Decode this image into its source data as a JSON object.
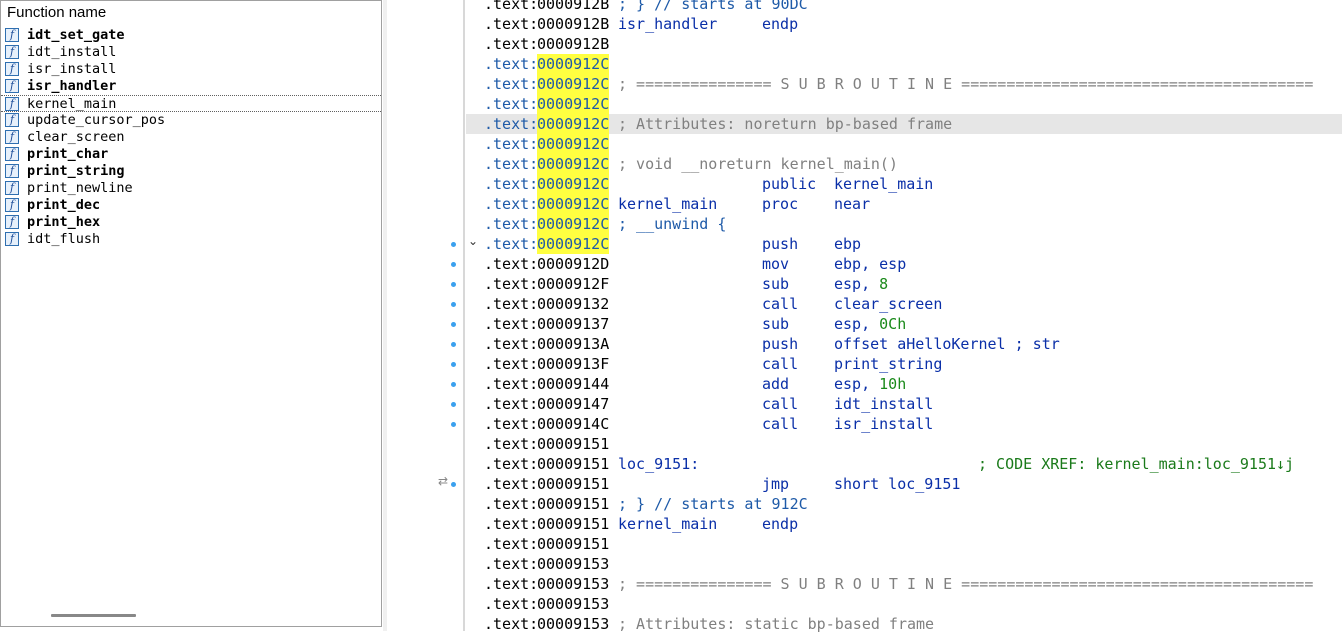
{
  "functions_panel": {
    "header": "Function name",
    "icon_glyph": "f",
    "items": [
      {
        "name": "idt_set_gate",
        "bold": true,
        "selected": false
      },
      {
        "name": "idt_install",
        "bold": false,
        "selected": false
      },
      {
        "name": "isr_install",
        "bold": false,
        "selected": false
      },
      {
        "name": "isr_handler",
        "bold": true,
        "selected": false
      },
      {
        "name": "kernel_main",
        "bold": false,
        "selected": true
      },
      {
        "name": "update_cursor_pos",
        "bold": false,
        "selected": false
      },
      {
        "name": "clear_screen",
        "bold": false,
        "selected": false
      },
      {
        "name": "print_char",
        "bold": true,
        "selected": false
      },
      {
        "name": "print_string",
        "bold": true,
        "selected": false
      },
      {
        "name": "print_newline",
        "bold": false,
        "selected": false
      },
      {
        "name": "print_dec",
        "bold": true,
        "selected": false
      },
      {
        "name": "print_hex",
        "bold": true,
        "selected": false
      },
      {
        "name": "idt_flush",
        "bold": false,
        "selected": false
      }
    ]
  },
  "disassembly": {
    "collapse_arrow": "⌄",
    "jump_arrow": "⇄",
    "lines": [
      {
        "seg": ".text:",
        "addr": "0000912B",
        "cmt_blue": "; } // starts at 90DC"
      },
      {
        "seg": ".text:",
        "addr": "0000912B",
        "label": "isr_handler",
        "mnem": "endp"
      },
      {
        "seg": ".text:",
        "addr": "0000912B"
      },
      {
        "seg": ".text:",
        "addr": "0000912C",
        "yellow": true
      },
      {
        "seg": ".text:",
        "addr": "0000912C",
        "yellow": true,
        "cmt_gray": "; =============== S U B R O U T I N E ======================================="
      },
      {
        "seg": ".text:",
        "addr": "0000912C",
        "yellow": true
      },
      {
        "seg": ".text:",
        "addr": "0000912C",
        "yellow": true,
        "highlight": true,
        "cmt_gray": "; Attributes: noreturn bp-based frame"
      },
      {
        "seg": ".text:",
        "addr": "0000912C",
        "yellow": true
      },
      {
        "seg": ".text:",
        "addr": "0000912C",
        "yellow": true,
        "cmt_gray": "; void __noreturn kernel_main()"
      },
      {
        "seg": ".text:",
        "addr": "0000912C",
        "yellow": true,
        "mnem": "public",
        "op": "kernel_main"
      },
      {
        "seg": ".text:",
        "addr": "0000912C",
        "yellow": true,
        "label": "kernel_main",
        "mnem": "proc",
        "op": "near"
      },
      {
        "seg": ".text:",
        "addr": "0000912C",
        "yellow": true,
        "cmt_blue": "; __unwind {"
      },
      {
        "seg": ".text:",
        "addr": "0000912C",
        "yellow": true,
        "mnem": "push",
        "op": "ebp",
        "dot": true
      },
      {
        "seg": ".text:",
        "addr": "0000912D",
        "mnem": "mov",
        "op": "ebp, esp",
        "dot": true
      },
      {
        "seg": ".text:",
        "addr": "0000912F",
        "mnem": "sub",
        "op": "esp, ",
        "num": "8",
        "dot": true
      },
      {
        "seg": ".text:",
        "addr": "00009132",
        "mnem": "call",
        "op": "clear_screen",
        "dot": true
      },
      {
        "seg": ".text:",
        "addr": "00009137",
        "mnem": "sub",
        "op": "esp, ",
        "num": "0Ch",
        "dot": true
      },
      {
        "seg": ".text:",
        "addr": "0000913A",
        "mnem": "push",
        "op": "offset aHelloKernel ; str",
        "dot": true
      },
      {
        "seg": ".text:",
        "addr": "0000913F",
        "mnem": "call",
        "op": "print_string",
        "dot": true
      },
      {
        "seg": ".text:",
        "addr": "00009144",
        "mnem": "add",
        "op": "esp, ",
        "num": "10h",
        "dot": true
      },
      {
        "seg": ".text:",
        "addr": "00009147",
        "mnem": "call",
        "op": "idt_install",
        "dot": true
      },
      {
        "seg": ".text:",
        "addr": "0000914C",
        "mnem": "call",
        "op": "isr_install",
        "dot": true
      },
      {
        "seg": ".text:",
        "addr": "00009151"
      },
      {
        "seg": ".text:",
        "addr": "00009151",
        "label": "loc_9151:",
        "xref": "; CODE XREF: kernel_main:loc_9151↓j"
      },
      {
        "seg": ".text:",
        "addr": "00009151",
        "mnem": "jmp",
        "op": "short loc_9151",
        "dot": true,
        "jump": true
      },
      {
        "seg": ".text:",
        "addr": "00009151",
        "cmt_blue": "; } // starts at 912C"
      },
      {
        "seg": ".text:",
        "addr": "00009151",
        "label": "kernel_main",
        "mnem": "endp"
      },
      {
        "seg": ".text:",
        "addr": "00009151"
      },
      {
        "seg": ".text:",
        "addr": "00009153"
      },
      {
        "seg": ".text:",
        "addr": "00009153",
        "cmt_gray": "; =============== S U B R O U T I N E ======================================="
      },
      {
        "seg": ".text:",
        "addr": "00009153"
      },
      {
        "seg": ".text:",
        "addr": "00009153",
        "cmt_gray": "; Attributes: static bp-based frame"
      }
    ]
  }
}
